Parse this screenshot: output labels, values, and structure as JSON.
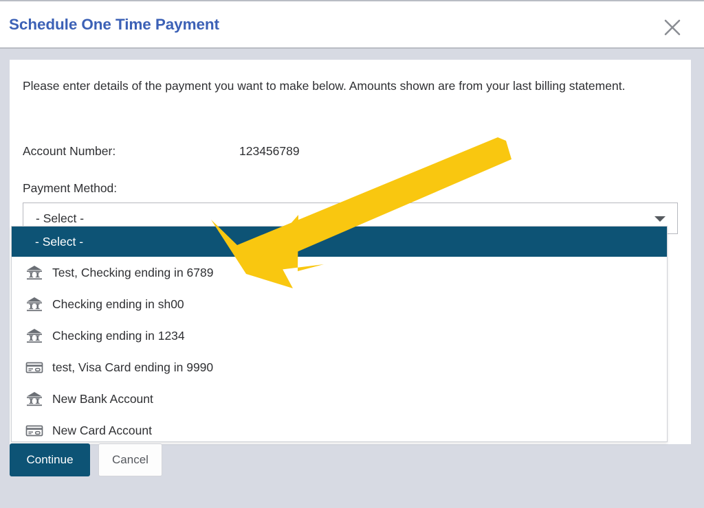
{
  "header": {
    "title": "Schedule One Time Payment",
    "close_icon": "close-icon"
  },
  "main": {
    "intro_text": "Please enter details of the payment you want to make below. Amounts shown are from your last billing statement.",
    "account_number_label": "Account Number:",
    "account_number_value": "123456789",
    "payment_method_label": "Payment Method:",
    "select": {
      "value": "- Select -",
      "arrow_icon": "chevron-down-icon",
      "expanded": true,
      "options": [
        {
          "label": "- Select -",
          "icon": "none",
          "selected": true
        },
        {
          "label": "Test, Checking ending in 6789",
          "icon": "bank-icon",
          "selected": false
        },
        {
          "label": "Checking ending in sh00",
          "icon": "bank-icon",
          "selected": false
        },
        {
          "label": "Checking ending in 1234",
          "icon": "bank-icon",
          "selected": false
        },
        {
          "label": "test, Visa Card ending in 9990",
          "icon": "credit-card-icon",
          "selected": false
        },
        {
          "label": "New Bank Account",
          "icon": "bank-icon",
          "selected": false
        },
        {
          "label": "New Card Account",
          "icon": "credit-card-icon",
          "selected": false
        }
      ]
    }
  },
  "footer": {
    "continue_label": "Continue",
    "cancel_label": "Cancel"
  },
  "annotation": {
    "type": "arrow",
    "color": "#F9C710",
    "points_to": "Test, Checking ending in 6789"
  },
  "colors": {
    "title_blue": "#3C61B6",
    "accent_teal": "#0D5375",
    "page_background": "#D7DAE3",
    "card_background": "#FFFFFF",
    "annotation_yellow": "#F9C710"
  }
}
